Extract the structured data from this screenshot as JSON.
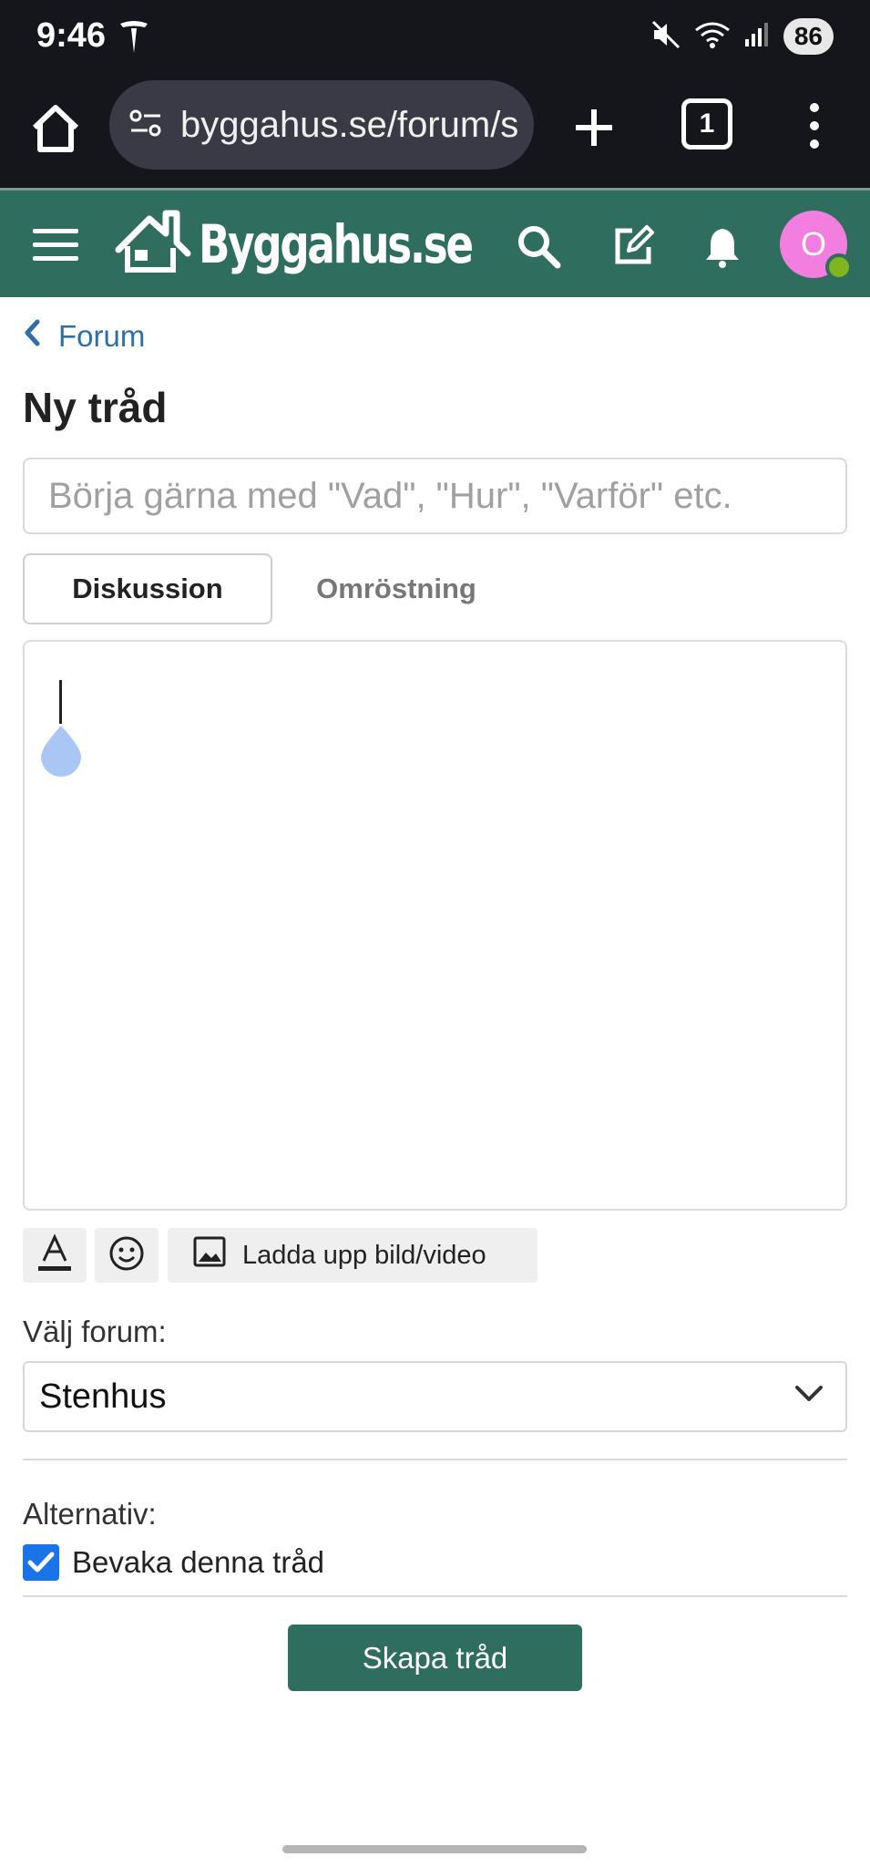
{
  "status_bar": {
    "time": "9:46",
    "battery": "86",
    "icons": [
      "tesla-icon",
      "mute-icon",
      "wifi-icon",
      "signal-icon"
    ]
  },
  "browser": {
    "url": "byggahus.se/forum/s",
    "tab_count": "1"
  },
  "site": {
    "logo_text": "Byggahus.se",
    "avatar_initial": "O",
    "brand_color": "#2f6e5f",
    "avatar_color": "#f27ee0",
    "online_color": "#7fb51f"
  },
  "breadcrumb": {
    "label": "Forum"
  },
  "page": {
    "title": "Ny tråd",
    "title_placeholder": "Börja gärna med \"Vad\", \"Hur\", \"Varför\" etc."
  },
  "tabs": [
    {
      "label": "Diskussion",
      "active": true
    },
    {
      "label": "Omröstning",
      "active": false
    }
  ],
  "toolbar": {
    "upload_label": "Ladda upp bild/video"
  },
  "forum_select": {
    "label": "Välj forum:",
    "selected": "Stenhus"
  },
  "options": {
    "label": "Alternativ:",
    "watch_label": "Bevaka denna tråd",
    "watch_checked": true
  },
  "submit": {
    "label": "Skapa tråd"
  }
}
